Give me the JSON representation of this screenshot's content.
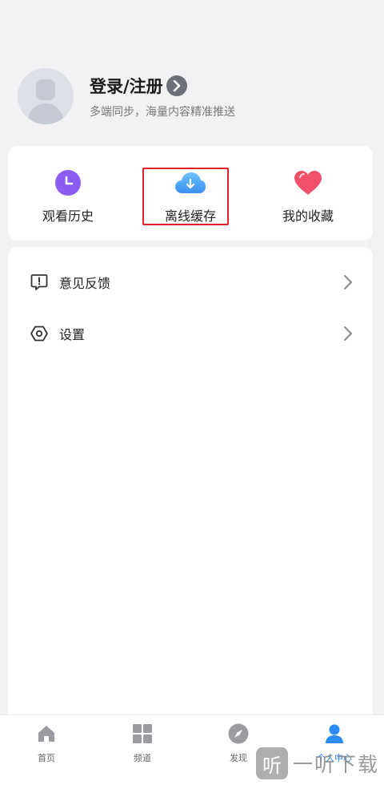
{
  "profile": {
    "title": "登录/注册",
    "subtitle": "多端同步，海量内容精准推送"
  },
  "quick_actions": [
    {
      "label": "观看历史",
      "icon": "clock-icon",
      "color": "#8a5cf0"
    },
    {
      "label": "离线缓存",
      "icon": "cloud-download-icon",
      "color": "#4aa8f2",
      "highlighted": true
    },
    {
      "label": "我的收藏",
      "icon": "heart-icon",
      "color": "#f0506a"
    }
  ],
  "menu": [
    {
      "label": "意见反馈",
      "icon": "feedback-icon"
    },
    {
      "label": "设置",
      "icon": "settings-icon"
    }
  ],
  "tabbar": [
    {
      "label": "首页",
      "icon": "home-icon"
    },
    {
      "label": "频道",
      "icon": "grid-icon"
    },
    {
      "label": "发现",
      "icon": "compass-icon"
    },
    {
      "label": "个人中心",
      "icon": "user-icon",
      "active": true
    }
  ],
  "watermark": {
    "badge": "听",
    "text": "一听下载"
  },
  "colors": {
    "accent": "#2a8cf4",
    "highlight": "#e0202a",
    "background": "#f2f2f4"
  }
}
